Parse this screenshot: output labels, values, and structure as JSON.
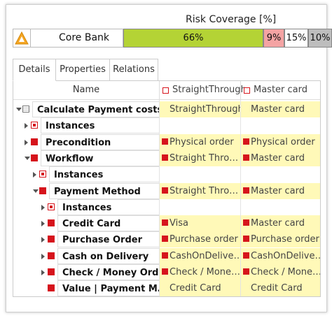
{
  "risk_coverage": {
    "title": "Risk Coverage [%]",
    "row_name": "Core Bank",
    "icon": "warning-triangle-icon",
    "bars": [
      {
        "label": "66%",
        "value": 66,
        "color": "#b4d335"
      },
      {
        "label": "9%",
        "value": 9,
        "color": "#f4a3a3"
      },
      {
        "label": "15%",
        "value": 15,
        "color": "#ffffff"
      },
      {
        "label": "10%",
        "value": 10,
        "color": "#bdbdbd"
      }
    ]
  },
  "tabs": [
    {
      "label": "Details",
      "active": true
    },
    {
      "label": "Properties",
      "active": false
    },
    {
      "label": "Relations",
      "active": false
    }
  ],
  "grid": {
    "header": {
      "name": "Name",
      "col1": "StraightThrough",
      "col2": "Master card"
    },
    "rows": [
      {
        "label": "Calculate Payment costs",
        "icon": "table",
        "expander": "down",
        "c1": "StraightThrough",
        "c2": "Master card",
        "yellow": true,
        "c1_icon": false,
        "c2_icon": false
      },
      {
        "label": "Instances",
        "icon": "inst",
        "expander": "right",
        "c1": "",
        "c2": "",
        "yellow": false,
        "c1_icon": false,
        "c2_icon": false
      },
      {
        "label": "Precondition",
        "icon": "red",
        "expander": "right",
        "c1": "Physical order",
        "c2": "Physical order",
        "yellow": true,
        "c1_icon": true,
        "c2_icon": true
      },
      {
        "label": "Workflow",
        "icon": "red",
        "expander": "down",
        "c1": "Straight Thro…",
        "c2": "Master card",
        "yellow": true,
        "c1_icon": true,
        "c2_icon": true
      },
      {
        "label": "Instances",
        "icon": "inst",
        "expander": "right",
        "c1": "",
        "c2": "",
        "yellow": false,
        "c1_icon": false,
        "c2_icon": false
      },
      {
        "label": "Payment Method",
        "icon": "red",
        "expander": "down",
        "c1": "Straight Thro…",
        "c2": "Master card",
        "yellow": true,
        "c1_icon": true,
        "c2_icon": true
      },
      {
        "label": "Instances",
        "icon": "inst",
        "expander": "right",
        "c1": "",
        "c2": "",
        "yellow": false,
        "c1_icon": false,
        "c2_icon": false
      },
      {
        "label": "Credit Card",
        "icon": "red",
        "expander": "right",
        "c1": "Visa",
        "c2": "Master card",
        "yellow": true,
        "c1_icon": true,
        "c2_icon": true
      },
      {
        "label": "Purchase Order",
        "icon": "red",
        "expander": "right",
        "c1": "Purchase order",
        "c2": "Purchase order",
        "yellow": true,
        "c1_icon": true,
        "c2_icon": true
      },
      {
        "label": "Cash on Delivery",
        "icon": "red",
        "expander": "right",
        "c1": "CashOnDelive…",
        "c2": "CashOnDelive…",
        "yellow": true,
        "c1_icon": true,
        "c2_icon": true
      },
      {
        "label": "Check / Money Order",
        "icon": "red",
        "expander": "right",
        "c1": "Check / Mone…",
        "c2": "Check / Mone…",
        "yellow": true,
        "c1_icon": true,
        "c2_icon": true
      },
      {
        "label": "Value | Payment M…",
        "icon": "red",
        "expander": "none",
        "c1": "Credit Card",
        "c2": "Credit Card",
        "yellow": true,
        "c1_icon": false,
        "c2_icon": false
      }
    ]
  }
}
